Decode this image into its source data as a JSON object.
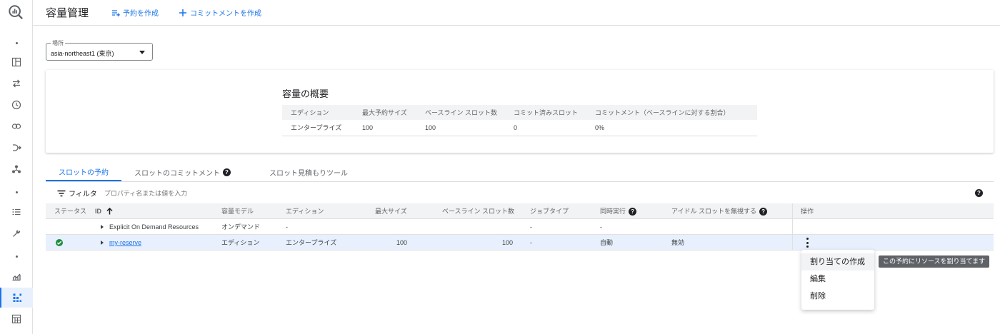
{
  "header": {
    "title": "容量管理",
    "create_reservation": "予約を作成",
    "create_commitment": "コミットメントを作成"
  },
  "location": {
    "label": "場所",
    "value": "asia-northeast1 (東京)"
  },
  "summary": {
    "title": "容量の概要",
    "columns": [
      "エディション",
      "最大予約サイズ",
      "ベースライン スロット数",
      "コミット済みスロット",
      "コミットメント（ベースラインに対する割合）"
    ],
    "row": [
      "エンタープライズ",
      "100",
      "100",
      "0",
      "0%"
    ]
  },
  "tabs": [
    {
      "label": "スロットの予約"
    },
    {
      "label": "スロットのコミットメント"
    },
    {
      "label": "スロット見積もりツール"
    }
  ],
  "filter": {
    "label": "フィルタ",
    "placeholder": "プロパティ名または値を入力"
  },
  "table": {
    "headers": {
      "status": "ステータス",
      "id": "ID",
      "model": "容量モデル",
      "edition": "エディション",
      "max": "最大サイズ",
      "baseline": "ベースライン スロット数",
      "jobtype": "ジョブタイプ",
      "concurrency": "同時実行",
      "idle": "アイドル スロットを無視する",
      "ops": "操作"
    },
    "rows": [
      {
        "id": "Explicit On Demand Resources",
        "model": "オンデマンド",
        "edition": "-",
        "max": "",
        "baseline": "",
        "jobtype": "-",
        "concurrency": "-",
        "idle": ""
      },
      {
        "id": "my-reserve",
        "model": "エディション",
        "edition": "エンタープライズ",
        "max": "100",
        "baseline": "100",
        "jobtype": "-",
        "concurrency": "自動",
        "idle": "無効"
      }
    ]
  },
  "menu": {
    "items": [
      "割り当ての作成",
      "編集",
      "削除"
    ],
    "tooltip": "この予約にリソースを割り当てます"
  },
  "colors": {
    "accent": "#1a73e8",
    "success": "#1e8e3e"
  }
}
